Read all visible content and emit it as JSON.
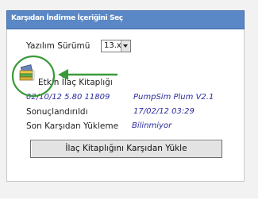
{
  "panel": {
    "header_title": "Karşıdan İndirme İçeriğini Seç"
  },
  "software_version": {
    "label": "Yazılım Sürümü",
    "value": "13.x"
  },
  "library": {
    "name": "Etkin İlaç Kitaplığı",
    "details_left": "02/10/12 5.80 11809",
    "details_right": "PumpSim Plum V2.1",
    "updated_label": "Sonuçlandırıldı",
    "updated_value": "17/02/12 03:29",
    "last_download_label": "Son Karşıdan Yükleme",
    "last_download_value": "Bilinmiyor"
  },
  "download_button": {
    "label": "İlaç Kitaplığını Karşıdan Yükle"
  },
  "colors": {
    "header": "#5a87c5",
    "annotation": "#3a9a3a",
    "italic_text": "#2a2aa0"
  },
  "icons": {
    "library": "book-stack-icon",
    "dropdown": "chevron-down-icon",
    "annotation_circle": "highlight-circle",
    "annotation_arrow": "arrow-left"
  }
}
